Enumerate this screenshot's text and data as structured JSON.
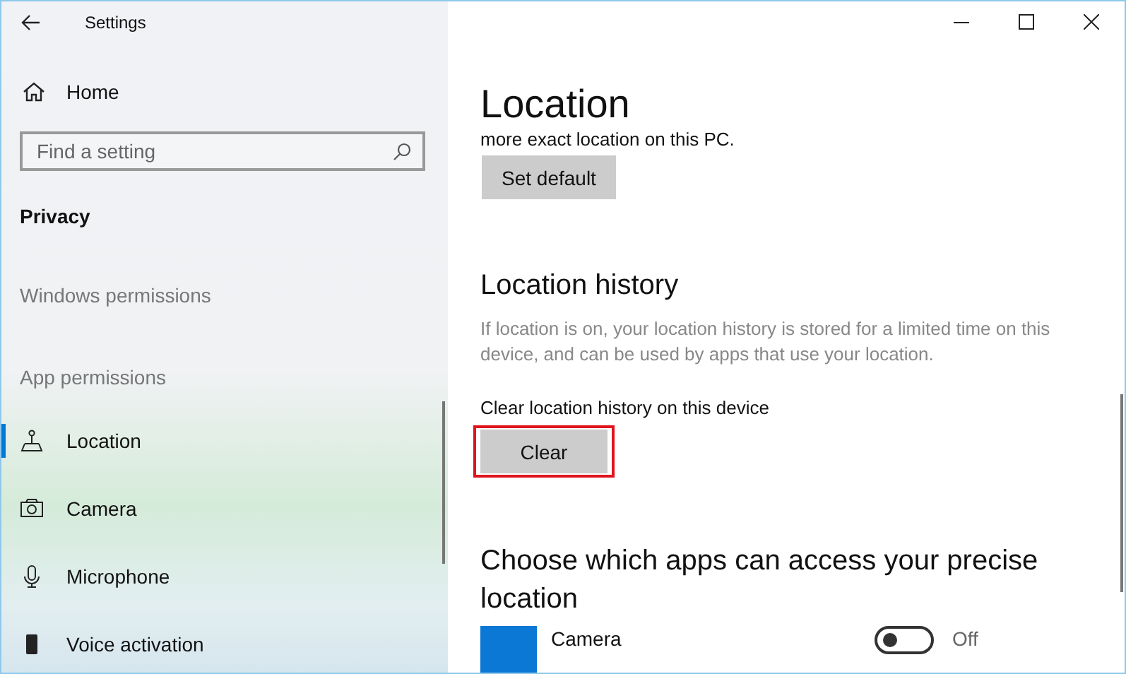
{
  "window": {
    "title": "Settings"
  },
  "sidebar": {
    "home": "Home",
    "search": {
      "placeholder": "Find a setting"
    },
    "category": "Privacy",
    "sections": [
      {
        "heading": "Windows permissions"
      },
      {
        "heading": "App permissions",
        "items": [
          {
            "label": "Location",
            "selected": true
          },
          {
            "label": "Camera",
            "selected": false
          },
          {
            "label": "Microphone",
            "selected": false
          },
          {
            "label": "Voice activation",
            "selected": false
          }
        ]
      }
    ]
  },
  "page": {
    "title": "Location",
    "cut_text": "more exact location on this PC.",
    "set_default_button": "Set default",
    "history": {
      "heading": "Location history",
      "description": "If location is on, your location history is stored for a limited time on this device, and can be used by apps that use your location.",
      "clear_label": "Clear location history on this device",
      "clear_button": {
        "label": "Clear",
        "highlighted": true
      }
    },
    "apps": {
      "heading": "Choose which apps can access your precise location",
      "items": [
        {
          "name": "Camera",
          "on": false,
          "state": "Off"
        }
      ]
    }
  }
}
